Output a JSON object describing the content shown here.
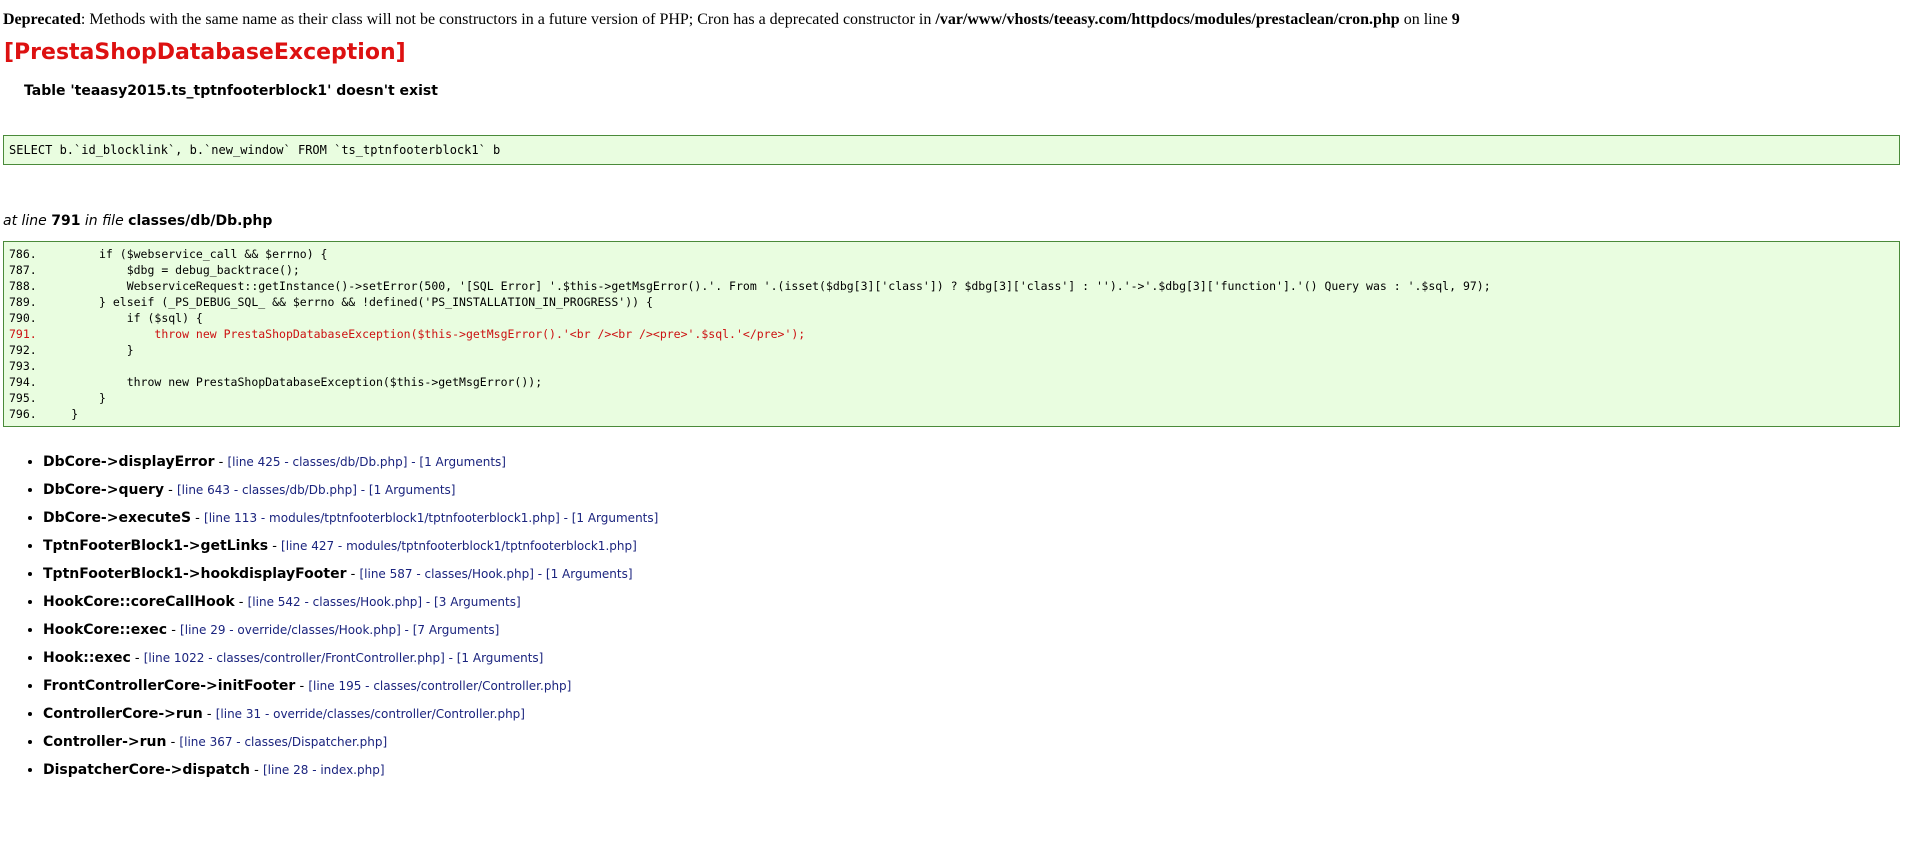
{
  "deprecated": {
    "label": "Deprecated",
    "message": ": Methods with the same name as their class will not be constructors in a future version of PHP; Cron has a deprecated constructor in ",
    "path": "/var/www/vhosts/teeasy.com/httpdocs/modules/prestaclean/cron.php",
    "on_line_text": " on line ",
    "line": "9"
  },
  "exception": {
    "title": "[PrestaShopDatabaseException]",
    "message": "Table 'teaasy2015.ts_tptnfooterblock1' doesn't exist",
    "sql": "SELECT b.`id_blocklink`, b.`new_window` FROM `ts_tptnfooterblock1` b"
  },
  "location": {
    "at_line_text": "at line ",
    "line": "791",
    "in_file_text": " in file ",
    "file": "classes/db/Db.php"
  },
  "code_lines": [
    {
      "text": "786.         if ($webservice_call && $errno) {",
      "highlight": false
    },
    {
      "text": "787.             $dbg = debug_backtrace();",
      "highlight": false
    },
    {
      "text": "788.             WebserviceRequest::getInstance()->setError(500, '[SQL Error] '.$this->getMsgError().'. From '.(isset($dbg[3]['class']) ? $dbg[3]['class'] : '').'->'.$dbg[3]['function'].'() Query was : '.$sql, 97);",
      "highlight": false
    },
    {
      "text": "789.         } elseif (_PS_DEBUG_SQL_ && $errno && !defined('PS_INSTALLATION_IN_PROGRESS')) {",
      "highlight": false
    },
    {
      "text": "790.             if ($sql) {",
      "highlight": false
    },
    {
      "text": "791.                 throw new PrestaShopDatabaseException($this->getMsgError().'<br /><br /><pre>'.$sql.'</pre>');",
      "highlight": true
    },
    {
      "text": "792.             }",
      "highlight": false
    },
    {
      "text": "793.",
      "highlight": false
    },
    {
      "text": "794.             throw new PrestaShopDatabaseException($this->getMsgError());",
      "highlight": false
    },
    {
      "text": "795.         }",
      "highlight": false
    },
    {
      "text": "796.     }",
      "highlight": false
    }
  ],
  "trace": [
    {
      "fn": "DbCore->displayError",
      "meta": "[line 425 - classes/db/Db.php] - [1 Arguments]"
    },
    {
      "fn": "DbCore->query",
      "meta": "[line 643 - classes/db/Db.php] - [1 Arguments]"
    },
    {
      "fn": "DbCore->executeS",
      "meta": "[line 113 - modules/tptnfooterblock1/tptnfooterblock1.php] - [1 Arguments]"
    },
    {
      "fn": "TptnFooterBlock1->getLinks",
      "meta": "[line 427 - modules/tptnfooterblock1/tptnfooterblock1.php]"
    },
    {
      "fn": "TptnFooterBlock1->hookdisplayFooter",
      "meta": "[line 587 - classes/Hook.php] - [1 Arguments]"
    },
    {
      "fn": "HookCore::coreCallHook",
      "meta": "[line 542 - classes/Hook.php] - [3 Arguments]"
    },
    {
      "fn": "HookCore::exec",
      "meta": "[line 29 - override/classes/Hook.php] - [7 Arguments]"
    },
    {
      "fn": "Hook::exec",
      "meta": "[line 1022 - classes/controller/FrontController.php] - [1 Arguments]"
    },
    {
      "fn": "FrontControllerCore->initFooter",
      "meta": "[line 195 - classes/controller/Controller.php]"
    },
    {
      "fn": "ControllerCore->run",
      "meta": "[line 31 - override/classes/controller/Controller.php]"
    },
    {
      "fn": "Controller->run",
      "meta": "[line 367 - classes/Dispatcher.php]"
    },
    {
      "fn": "DispatcherCore->dispatch",
      "meta": "[line 28 - index.php]"
    }
  ],
  "separator": " - "
}
